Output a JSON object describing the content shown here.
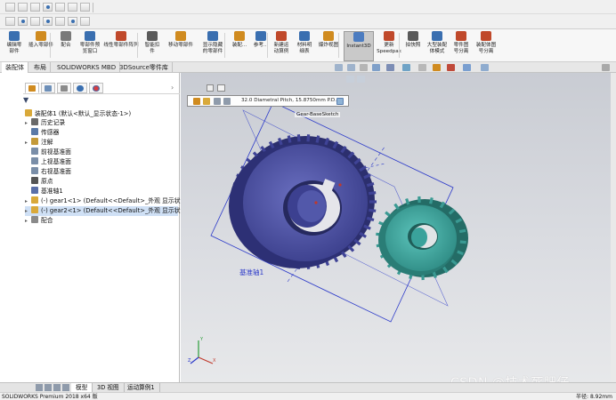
{
  "ribbon": {
    "buttons": [
      {
        "label1": "编辑零",
        "label2": "部件",
        "icon": "edit-component-icon",
        "color": "#3a6fb0"
      },
      {
        "label1": "插入零部件",
        "label2": "",
        "icon": "insert-component-icon",
        "color": "#d08b1f"
      },
      {
        "label1": "配合",
        "label2": "",
        "icon": "mate-icon",
        "color": "#7a7a7a"
      },
      {
        "label1": "零部件预",
        "label2": "览窗口",
        "icon": "preview-window-icon",
        "color": "#3a6fb0"
      },
      {
        "label1": "线性零部件阵列",
        "label2": "",
        "icon": "linear-pattern-icon",
        "color": "#c0492b"
      },
      {
        "label1": "智能扣",
        "label2": "件",
        "icon": "smart-fastener-icon",
        "color": "#5a5a5a"
      },
      {
        "label1": "移动零部件",
        "label2": "",
        "icon": "move-component-icon",
        "color": "#d08b1f"
      },
      {
        "label1": "显示隐藏",
        "label2": "的零部件",
        "icon": "show-hidden-icon",
        "color": "#3a6fb0"
      },
      {
        "label1": "装配...",
        "label2": "",
        "icon": "assembly-features-icon",
        "color": "#d08b1f"
      },
      {
        "label1": "参考...",
        "label2": "",
        "icon": "reference-geometry-icon",
        "color": "#3a6fb0"
      },
      {
        "label1": "新建运",
        "label2": "动算例",
        "icon": "motion-study-icon",
        "color": "#c0492b"
      },
      {
        "label1": "材料明",
        "label2": "细表",
        "icon": "bom-icon",
        "color": "#3a6fb0"
      },
      {
        "label1": "爆炸视图",
        "label2": "",
        "icon": "exploded-view-icon",
        "color": "#d08b1f"
      },
      {
        "label1": "Instant3D",
        "label2": "",
        "icon": "instant3d-icon",
        "color": "#4c7cc0"
      },
      {
        "label1": "更新",
        "label2": "Speedpak",
        "icon": "speedpak-icon",
        "color": "#c0492b"
      },
      {
        "label1": "拍快照",
        "label2": "",
        "icon": "snapshot-icon",
        "color": "#5a5a5a"
      },
      {
        "label1": "大型装配",
        "label2": "体模式",
        "icon": "large-assembly-icon",
        "color": "#3a6fb0"
      },
      {
        "label1": "零件图",
        "label2": "号分离",
        "icon": "part-number-icon",
        "color": "#c0492b"
      },
      {
        "label1": "装配体图",
        "label2": "号分离",
        "icon": "assembly-number-icon",
        "color": "#c0492b"
      }
    ]
  },
  "tabs": [
    "装配体",
    "布局",
    "SOLIDWORKS MBD",
    "3DSource零件库"
  ],
  "tree": {
    "filter_icon": "filter-icon",
    "root": "装配体1 (默认<默认_显示状态-1>)",
    "items": [
      {
        "label": "历史记录",
        "icon": "history-icon",
        "expand": "▸",
        "color": "#6a6a6a"
      },
      {
        "label": "传感器",
        "icon": "sensor-icon",
        "expand": "",
        "color": "#5a7aa8"
      },
      {
        "label": "注解",
        "icon": "annotation-icon",
        "expand": "▸",
        "color": "#c49a3a"
      },
      {
        "label": "前视基准面",
        "icon": "plane-icon",
        "expand": "",
        "color": "#7a8ea8"
      },
      {
        "label": "上视基准面",
        "icon": "plane-icon",
        "expand": "",
        "color": "#7a8ea8"
      },
      {
        "label": "右视基准面",
        "icon": "plane-icon",
        "expand": "",
        "color": "#7a8ea8"
      },
      {
        "label": "原点",
        "icon": "origin-icon",
        "expand": "",
        "color": "#555555"
      },
      {
        "label": "基准轴1",
        "icon": "axis-icon",
        "expand": "",
        "color": "#5a6fa8"
      },
      {
        "label": "(-) gear1<1> (Default<<Default>_外观 显示状",
        "icon": "part-icon",
        "expand": "▸",
        "color": "#d9a93a"
      },
      {
        "label": "(-) gear2<1> (Default<<Default>_外观 显示状",
        "icon": "part-icon",
        "expand": "▸",
        "color": "#d9a93a"
      },
      {
        "label": "配合",
        "icon": "mates-folder-icon",
        "expand": "▸",
        "color": "#8a8a8a"
      }
    ],
    "selected_index": 9
  },
  "viewport": {
    "dimension_text": "32.0 Diametral Pitch, 15.8750mm P.D.",
    "callout": "Gear-BaseSketch",
    "axis_label": "基准轴1",
    "triad": {
      "x": "X",
      "y": "Y",
      "z": "Z"
    },
    "watermark": "CSDN @技术死肥仔"
  },
  "bottom_tabs": [
    "模型",
    "3D 视图",
    "运动算例1"
  ],
  "status": {
    "left": "SOLIDWORKS Premium 2018 x64 版",
    "right": "半径: 8.92mm"
  },
  "colors": {
    "gear1": "#4b50a6",
    "gear2": "#44a9a2",
    "sketch": "#2b39c9",
    "accent": "#1f5fb0"
  }
}
